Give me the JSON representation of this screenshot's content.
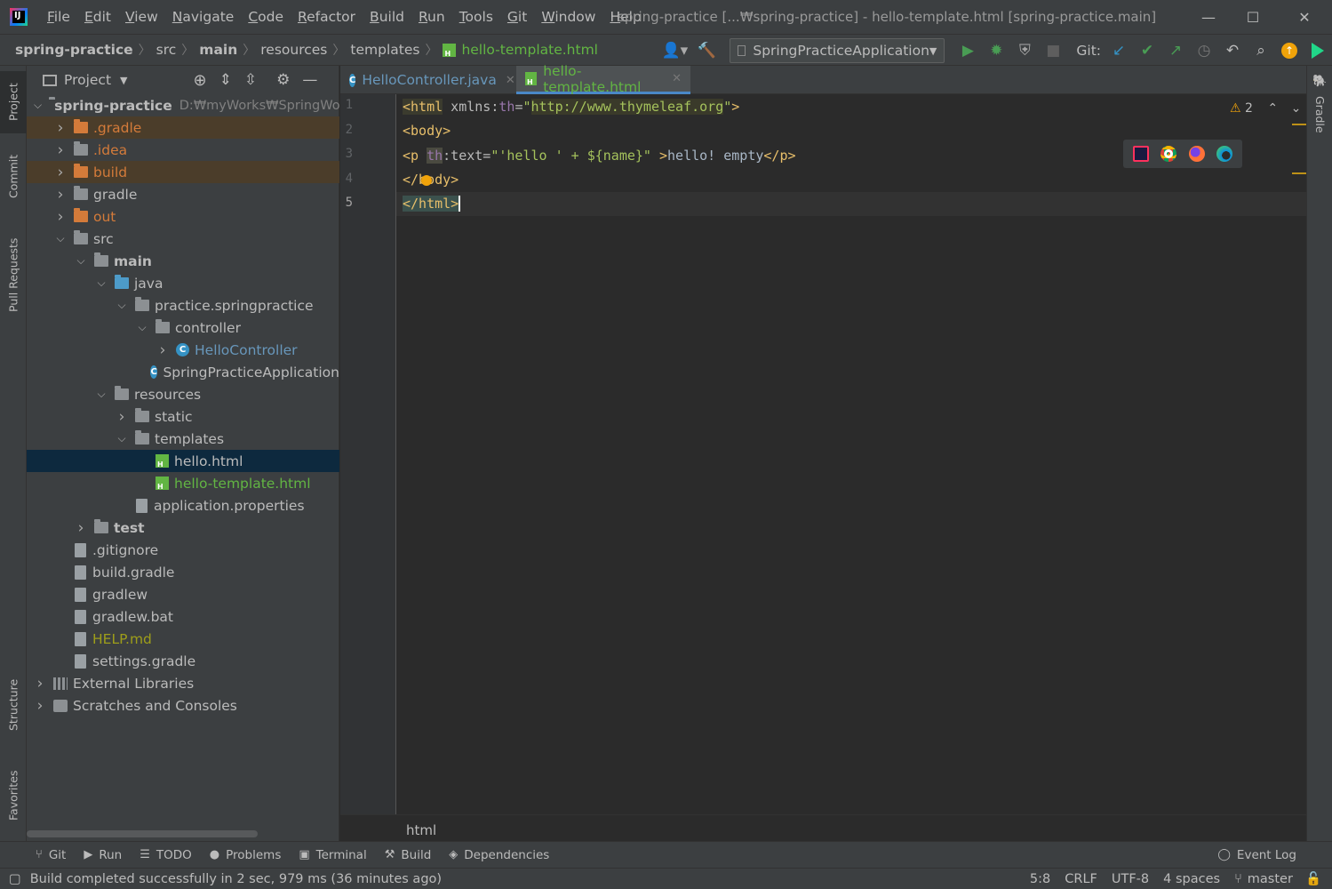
{
  "window": {
    "title": "spring-practice [...₩spring-practice] - hello-template.html [spring-practice.main]",
    "minimize": "—",
    "maximize": "☐",
    "close": "✕"
  },
  "menu": [
    "File",
    "Edit",
    "View",
    "Navigate",
    "Code",
    "Refactor",
    "Build",
    "Run",
    "Tools",
    "Git",
    "Window",
    "Help"
  ],
  "breadcrumb": [
    "spring-practice",
    "src",
    "main",
    "resources",
    "templates",
    "hello-template.html"
  ],
  "toolbar": {
    "run_config": "SpringPracticeApplication",
    "git_label": "Git:"
  },
  "left_stripe": [
    "Project",
    "Commit",
    "Pull Requests",
    "Structure",
    "Favorites"
  ],
  "right_stripe": [
    "Gradle"
  ],
  "project_panel": {
    "title": "Project",
    "tree": [
      {
        "label": "spring-practice",
        "extra": "D:₩myWorks₩SpringWorks",
        "depth": 0,
        "icon": "module",
        "expanded": true,
        "bold": true
      },
      {
        "label": ".gradle",
        "depth": 1,
        "icon": "folder-orange",
        "expanded": false,
        "color": "#d47b3a",
        "highlight": true
      },
      {
        "label": ".idea",
        "depth": 1,
        "icon": "folder",
        "expanded": false,
        "color": "#d47b3a"
      },
      {
        "label": "build",
        "depth": 1,
        "icon": "folder-orange",
        "expanded": false,
        "color": "#d47b3a",
        "highlight": true
      },
      {
        "label": "gradle",
        "depth": 1,
        "icon": "folder",
        "expanded": false
      },
      {
        "label": "out",
        "depth": 1,
        "icon": "folder-orange",
        "expanded": false,
        "color": "#d47b3a"
      },
      {
        "label": "src",
        "depth": 1,
        "icon": "folder",
        "expanded": true
      },
      {
        "label": "main",
        "depth": 2,
        "icon": "folder",
        "expanded": true,
        "bold": true
      },
      {
        "label": "java",
        "depth": 3,
        "icon": "folder-blue",
        "expanded": true
      },
      {
        "label": "practice.springpractice",
        "depth": 4,
        "icon": "package",
        "expanded": true
      },
      {
        "label": "controller",
        "depth": 5,
        "icon": "package",
        "expanded": true
      },
      {
        "label": "HelloController",
        "depth": 6,
        "icon": "class",
        "color": "#6897bb"
      },
      {
        "label": "SpringPracticeApplication",
        "depth": 5,
        "icon": "class",
        "noarrow": true
      },
      {
        "label": "resources",
        "depth": 3,
        "icon": "folder",
        "expanded": true
      },
      {
        "label": "static",
        "depth": 4,
        "icon": "folder",
        "expanded": false
      },
      {
        "label": "templates",
        "depth": 4,
        "icon": "folder",
        "expanded": true
      },
      {
        "label": "hello.html",
        "depth": 5,
        "icon": "html",
        "selected": true,
        "noarrow": true
      },
      {
        "label": "hello-template.html",
        "depth": 5,
        "icon": "html",
        "color": "#62b543",
        "noarrow": true
      },
      {
        "label": "application.properties",
        "depth": 4,
        "icon": "file",
        "noarrow": true
      },
      {
        "label": "test",
        "depth": 2,
        "icon": "folder",
        "expanded": false,
        "bold": true
      },
      {
        "label": ".gitignore",
        "depth": 1,
        "icon": "file",
        "noarrow": true
      },
      {
        "label": "build.gradle",
        "depth": 1,
        "icon": "file",
        "noarrow": true
      },
      {
        "label": "gradlew",
        "depth": 1,
        "icon": "file",
        "noarrow": true
      },
      {
        "label": "gradlew.bat",
        "depth": 1,
        "icon": "file",
        "noarrow": true
      },
      {
        "label": "HELP.md",
        "depth": 1,
        "icon": "file",
        "color": "#9e9e1a",
        "noarrow": true
      },
      {
        "label": "settings.gradle",
        "depth": 1,
        "icon": "file",
        "noarrow": true
      },
      {
        "label": "External Libraries",
        "depth": 0,
        "icon": "lib",
        "expanded": false
      },
      {
        "label": "Scratches and Consoles",
        "depth": 0,
        "icon": "scratch",
        "expanded": false
      }
    ]
  },
  "tabs": [
    {
      "label": "HelloController.java",
      "active": false
    },
    {
      "label": "hello-template.html",
      "active": true
    }
  ],
  "editor": {
    "line_numbers": [
      "1",
      "2",
      "3",
      "4",
      "5"
    ],
    "warnings": "2",
    "breadcrumb": "html"
  },
  "tool_windows": [
    "Git",
    "Run",
    "TODO",
    "Problems",
    "Terminal",
    "Build",
    "Dependencies"
  ],
  "event_log": "Event Log",
  "status": {
    "message": "Build completed successfully in 2 sec, 979 ms (36 minutes ago)",
    "position": "5:8",
    "line_sep": "CRLF",
    "encoding": "UTF-8",
    "indent": "4 spaces",
    "branch": "master"
  }
}
